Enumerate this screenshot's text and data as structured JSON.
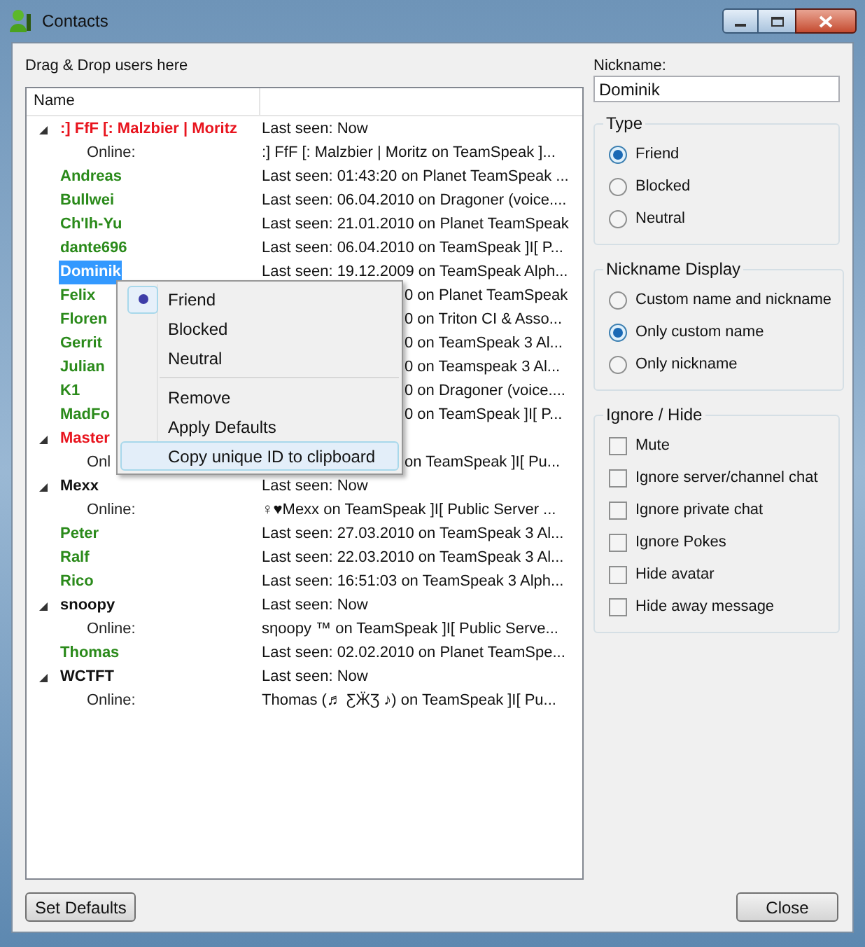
{
  "window": {
    "title": "Contacts"
  },
  "drop_label": "Drag & Drop users here",
  "list": {
    "columns": [
      "Name"
    ],
    "rows": [
      {
        "kind": "group",
        "name": ":] FfF [: Malzbier | Moritz",
        "color": "#e8141e",
        "expanded": true,
        "detail": "Last seen: Now",
        "selected": false,
        "covered": false
      },
      {
        "kind": "online",
        "name": "Online:",
        "detail": ":] FfF [: Malzbier | Moritz on TeamSpeak ]...",
        "selected": false,
        "covered": false
      },
      {
        "kind": "contact",
        "name": "Andreas",
        "color": "#2a8a1a",
        "detail": "Last seen: 01:43:20 on Planet TeamSpeak ...",
        "selected": false,
        "covered": false
      },
      {
        "kind": "contact",
        "name": "Bullwei",
        "color": "#2a8a1a",
        "detail": "Last seen: 06.04.2010 on Dragoner (voice....",
        "selected": false,
        "covered": false
      },
      {
        "kind": "contact",
        "name": "Ch'Ih-Yu",
        "color": "#2a8a1a",
        "detail": "Last seen: 21.01.2010 on Planet TeamSpeak",
        "selected": false,
        "covered": false
      },
      {
        "kind": "contact",
        "name": "dante696",
        "color": "#2a8a1a",
        "detail": "Last seen: 06.04.2010 on TeamSpeak ]I[ P...",
        "selected": false,
        "covered": false
      },
      {
        "kind": "contact",
        "name": "Dominik",
        "detail": "Last seen: 19.12.2009 on TeamSpeak Alph...",
        "selected": true,
        "covered": false
      },
      {
        "kind": "contact",
        "name": "Felix",
        "color": "#2a8a1a",
        "detail": "0 on Planet TeamSpeak",
        "selected": false,
        "covered": true
      },
      {
        "kind": "contact",
        "name": "Floren",
        "color": "#2a8a1a",
        "detail": "0 on Triton CI & Asso...",
        "selected": false,
        "covered": true
      },
      {
        "kind": "contact",
        "name": "Gerrit",
        "color": "#2a8a1a",
        "detail": "0 on TeamSpeak 3 Al...",
        "selected": false,
        "covered": true
      },
      {
        "kind": "contact",
        "name": "Julian",
        "color": "#2a8a1a",
        "detail": "0 on Teamspeak 3 Al...",
        "selected": false,
        "covered": true
      },
      {
        "kind": "contact",
        "name": "K1",
        "color": "#2a8a1a",
        "detail": "0 on Dragoner (voice....",
        "selected": false,
        "covered": true
      },
      {
        "kind": "contact",
        "name": "MadFo",
        "color": "#2a8a1a",
        "detail": "0 on TeamSpeak ]I[ P...",
        "selected": false,
        "covered": true
      },
      {
        "kind": "group",
        "name": "Master",
        "color": "#e8141e",
        "expanded": true,
        "selected": false
      },
      {
        "kind": "online",
        "name": "Onl",
        "detail": "on TeamSpeak ]I[ Pu...",
        "selected": false,
        "covered": true
      },
      {
        "kind": "group",
        "name": "Mexx",
        "color": "#111111",
        "expanded": true,
        "detail": "Last seen: Now",
        "selected": false,
        "covered": false
      },
      {
        "kind": "online",
        "name": "Online:",
        "detail": "♀♥Mexx on TeamSpeak ]I[ Public Server ...",
        "selected": false,
        "covered": false
      },
      {
        "kind": "contact",
        "name": "Peter",
        "color": "#2a8a1a",
        "detail": "Last seen: 27.03.2010 on TeamSpeak 3 Al...",
        "selected": false,
        "covered": false
      },
      {
        "kind": "contact",
        "name": "Ralf",
        "color": "#2a8a1a",
        "detail": "Last seen: 22.03.2010 on TeamSpeak 3 Al...",
        "selected": false,
        "covered": false
      },
      {
        "kind": "contact",
        "name": "Rico",
        "color": "#2a8a1a",
        "detail": "Last seen: 16:51:03 on TeamSpeak 3 Alph...",
        "selected": false,
        "covered": false
      },
      {
        "kind": "group",
        "name": "snoopy",
        "color": "#111111",
        "expanded": true,
        "detail": "Last seen: Now",
        "selected": false,
        "covered": false
      },
      {
        "kind": "online",
        "name": "Online:",
        "detail": "sηoopy ™ on TeamSpeak ]I[ Public Serve...",
        "selected": false,
        "covered": false
      },
      {
        "kind": "contact",
        "name": "Thomas",
        "color": "#2a8a1a",
        "detail": "Last seen: 02.02.2010 on Planet TeamSpe...",
        "selected": false,
        "covered": false
      },
      {
        "kind": "group",
        "name": "WCTFT",
        "color": "#111111",
        "expanded": true,
        "detail": "Last seen: Now",
        "selected": false,
        "covered": false
      },
      {
        "kind": "online",
        "name": "Online:",
        "detail": "Thomas (♬ ƸӜƷ ♪) on TeamSpeak ]I[ Pu...",
        "selected": false,
        "covered": false
      }
    ]
  },
  "context_menu": {
    "items": [
      {
        "kind": "radio",
        "label": "Friend",
        "checked": true,
        "selected": false
      },
      {
        "kind": "radio",
        "label": "Blocked",
        "checked": false,
        "selected": false
      },
      {
        "kind": "radio",
        "label": "Neutral",
        "checked": false,
        "selected": false
      },
      {
        "kind": "separator"
      },
      {
        "kind": "action",
        "label": "Remove",
        "selected": false
      },
      {
        "kind": "action",
        "label": "Apply Defaults",
        "selected": false
      },
      {
        "kind": "action",
        "label": "Copy unique ID to clipboard",
        "selected": true
      }
    ]
  },
  "nickname": {
    "label": "Nickname:",
    "value": "Dominik"
  },
  "type": {
    "title": "Type",
    "options": [
      {
        "label": "Friend",
        "selected": true
      },
      {
        "label": "Blocked",
        "selected": false
      },
      {
        "label": "Neutral",
        "selected": false
      }
    ]
  },
  "nickname_display": {
    "title": "Nickname Display",
    "options": [
      {
        "label": "Custom name and nickname",
        "selected": false
      },
      {
        "label": "Only custom name",
        "selected": true
      },
      {
        "label": "Only nickname",
        "selected": false
      }
    ]
  },
  "ignore_hide": {
    "title": "Ignore / Hide",
    "options": [
      {
        "label": "Mute",
        "checked": false
      },
      {
        "label": "Ignore server/channel chat",
        "checked": false
      },
      {
        "label": "Ignore private chat",
        "checked": false
      },
      {
        "label": "Ignore Pokes",
        "checked": false
      },
      {
        "label": "Hide avatar",
        "checked": false
      },
      {
        "label": "Hide away message",
        "checked": false
      }
    ]
  },
  "buttons": {
    "left": "Set Defaults",
    "right": "Close"
  }
}
